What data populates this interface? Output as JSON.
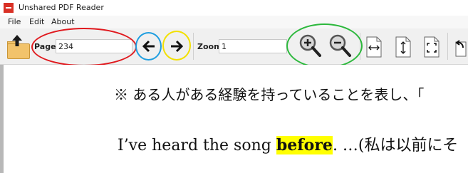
{
  "window": {
    "title": "Unshared PDF Reader"
  },
  "menu": {
    "items": [
      "File",
      "Edit",
      "About"
    ]
  },
  "toolbar": {
    "page_label": "Page",
    "page_value": "234",
    "zoom_label": "Zoom",
    "zoom_value": "1"
  },
  "icons": {
    "open": "open-folder-up-arrow-icon",
    "prev": "left-arrow-icon",
    "next": "right-arrow-icon",
    "zoom_in": "zoom-in-magnifier-icon",
    "zoom_out": "zoom-out-magnifier-icon",
    "fit_width": "fit-width-icon",
    "fit_height": "fit-height-icon",
    "fit_page": "fit-page-icon",
    "rotate": "rotate-icon"
  },
  "annotations": {
    "colors": {
      "page": "#e0191e",
      "prev": "#1f9ee0",
      "next": "#f2e000",
      "zoom": "#2db83d"
    }
  },
  "document": {
    "line1": "※ ある人がある経験を持っていることを表し、「",
    "line2_before": "I’ve heard the song ",
    "line2_highlight": "before",
    "line2_after": ".  …(私は以前にそ"
  },
  "colors": {
    "highlight": "#ffff00",
    "accent": "#d93025"
  }
}
